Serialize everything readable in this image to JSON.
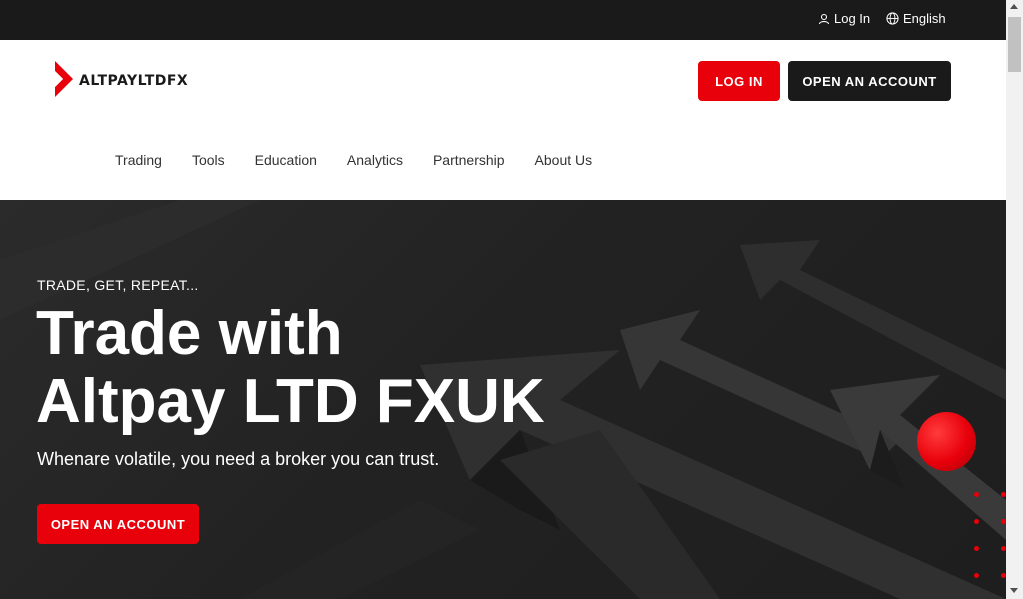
{
  "topbar": {
    "login_label": "Log In",
    "language_label": "English",
    "user_icon": "user-icon",
    "globe_icon": "globe-icon"
  },
  "header": {
    "logo_text": "ALTPAYLTDFX",
    "login_button": "LOG IN",
    "open_account_button": "OPEN AN ACCOUNT"
  },
  "nav": {
    "items": [
      {
        "label": "Trading"
      },
      {
        "label": "Tools"
      },
      {
        "label": "Education"
      },
      {
        "label": "Analytics"
      },
      {
        "label": "Partnership"
      },
      {
        "label": "About Us"
      }
    ]
  },
  "hero": {
    "eyebrow": "TRADE, GET, REPEAT...",
    "title_line1": "Trade with",
    "title_line2": "Altpay LTD FXUK",
    "subtitle": "Whenare volatile, you need a broker you can trust.",
    "cta_button": "OPEN AN ACCOUNT"
  },
  "colors": {
    "accent": "#e8000b",
    "dark": "#1a1a1a",
    "hero_bg": "#252525"
  }
}
